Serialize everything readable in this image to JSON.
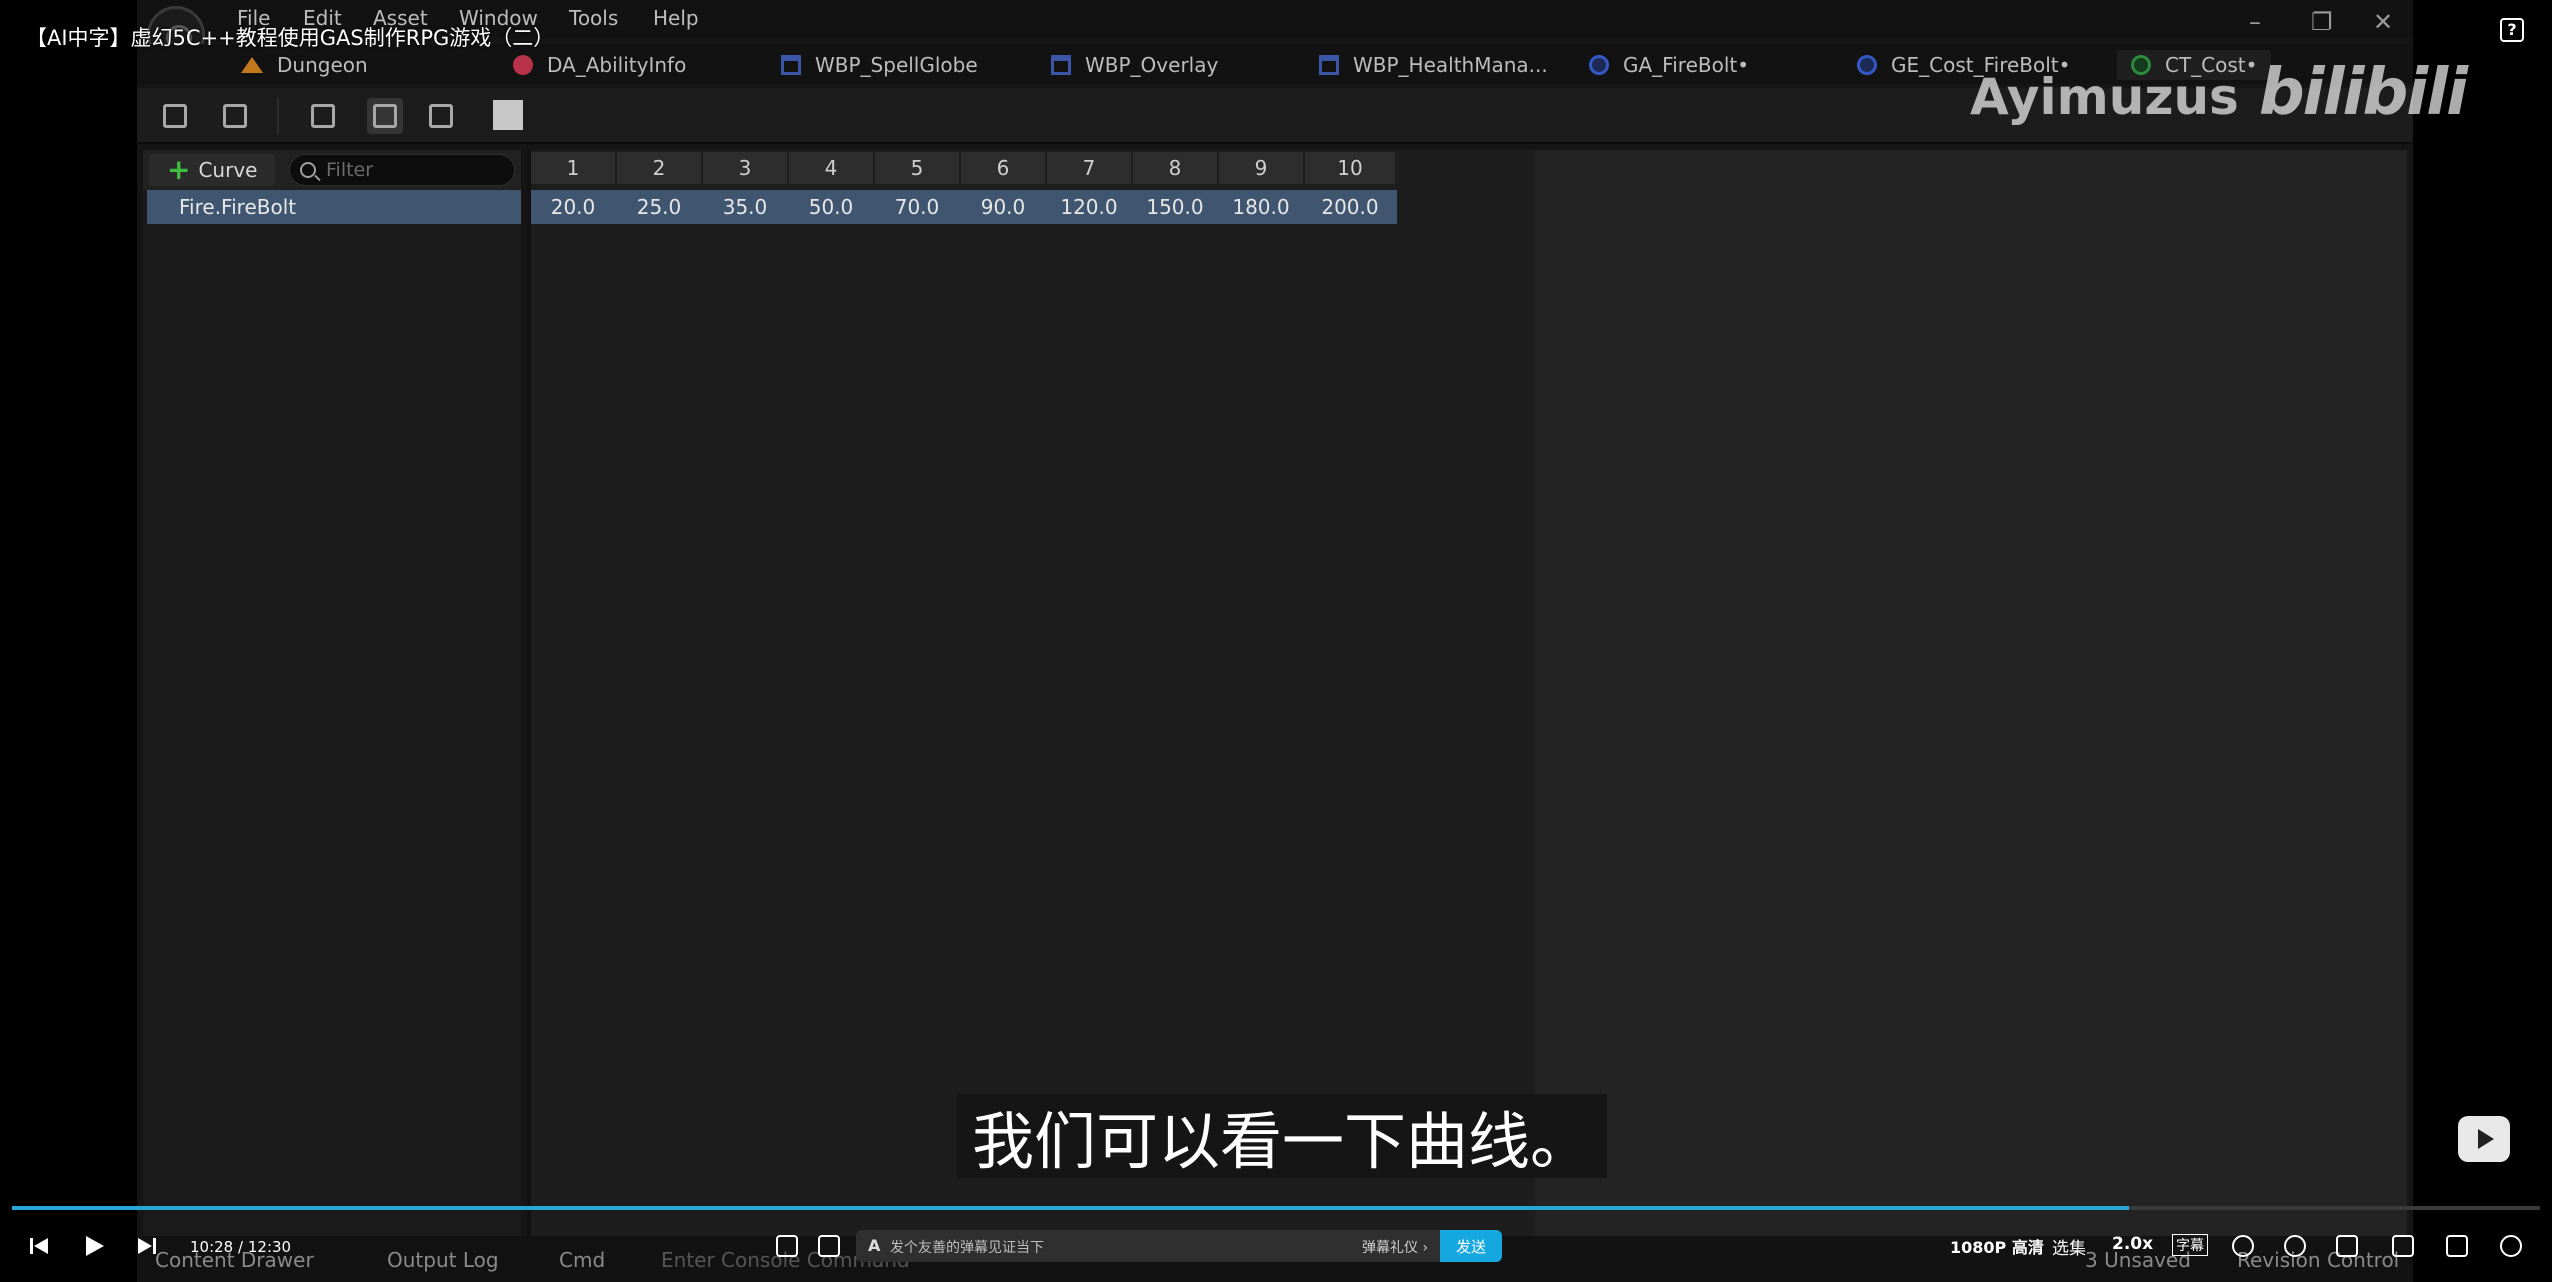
{
  "video": {
    "title": "【AI中字】虚幻5C++教程使用GAS制作RPG游戏（二）",
    "subtitle": "我们可以看一下曲线。",
    "watermark_name": "Ayimuzus",
    "watermark_brand": "bilibili",
    "time_current": "10:28",
    "time_sep": "/",
    "time_total": "12:30",
    "progress_fraction": 0.8373,
    "danmaku_placeholder": "发个友善的弹幕见证当下",
    "danmaku_etiquette": "弹幕礼仪 ›",
    "send_label": "发送",
    "quality": "1080P 高清",
    "episodes": "选集",
    "speed": "2.0x",
    "cc": "字幕"
  },
  "editor": {
    "menu": [
      "File",
      "Edit",
      "Asset",
      "Window",
      "Tools",
      "Help"
    ],
    "tabs": [
      {
        "label": "Dungeon",
        "icon": "level-icon"
      },
      {
        "label": "DA_AbilityInfo",
        "icon": "data-asset-icon"
      },
      {
        "label": "WBP_SpellGlobe",
        "icon": "widget-blueprint-icon"
      },
      {
        "label": "WBP_Overlay",
        "icon": "widget-blueprint-icon"
      },
      {
        "label": "WBP_HealthMana...",
        "icon": "widget-blueprint-icon"
      },
      {
        "label": "GA_FireBolt•",
        "icon": "blueprint-icon"
      },
      {
        "label": "GE_Cost_FireBolt•",
        "icon": "blueprint-icon"
      },
      {
        "label": "CT_Cost•",
        "icon": "curve-table-icon"
      }
    ],
    "toolbar": {
      "save_icon": "save-icon",
      "browse_icon": "browse-icon",
      "reimport_icon": "reimport-icon",
      "curve_view_icon": "curve-view-icon",
      "table_view_icon": "table-view-icon",
      "color_swatch": "#c7c7c7"
    },
    "curve_panel": {
      "add_label": "Curve",
      "filter_placeholder": "Filter",
      "rows": [
        "Fire.FireBolt"
      ]
    },
    "table": {
      "columns": [
        "1",
        "2",
        "3",
        "4",
        "5",
        "6",
        "7",
        "8",
        "9",
        "10"
      ],
      "rows": [
        {
          "name": "Fire.FireBolt",
          "values": [
            "20.0",
            "25.0",
            "35.0",
            "50.0",
            "70.0",
            "90.0",
            "120.0",
            "150.0",
            "180.0",
            "200.0"
          ]
        }
      ]
    },
    "status": {
      "content_drawer": "Content Drawer",
      "output_log": "Output Log",
      "cmd": "Cmd",
      "console_placeholder": "Enter Console Command",
      "unsaved": "3 Unsaved",
      "revision": "Revision Control"
    }
  },
  "colors": {
    "selection": "#3f5570",
    "accent": "#14a7e0",
    "progress": "#2aa6d8",
    "curve_plus": "#3fbf3f"
  }
}
